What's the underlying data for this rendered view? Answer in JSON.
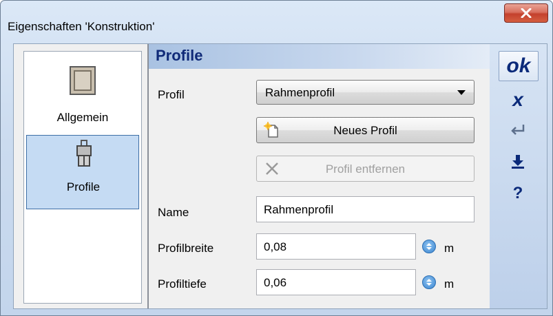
{
  "window": {
    "title": "Eigenschaften 'Konstruktion'",
    "close_icon": "close-icon"
  },
  "sidebar": {
    "items": [
      {
        "label": "Allgemein",
        "icon": "window-frame-icon",
        "selected": false
      },
      {
        "label": "Profile",
        "icon": "window-profile-icon",
        "selected": true
      }
    ]
  },
  "panel": {
    "heading": "Profile"
  },
  "form": {
    "profil_label": "Profil",
    "profil_value": "Rahmenprofil",
    "new_button": "Neues Profil",
    "remove_button": "Profil entfernen",
    "name_label": "Name",
    "name_value": "Rahmenprofil",
    "breite_label": "Profilbreite",
    "breite_value": "0,08",
    "breite_unit": "m",
    "tiefe_label": "Profiltiefe",
    "tiefe_value": "0,06",
    "tiefe_unit": "m"
  },
  "actions": {
    "ok": "ok",
    "cancel": "x",
    "help": "?"
  },
  "colors": {
    "accent": "#0b2a7a",
    "selection": "#c5dbf3",
    "close": "#c4412d"
  }
}
